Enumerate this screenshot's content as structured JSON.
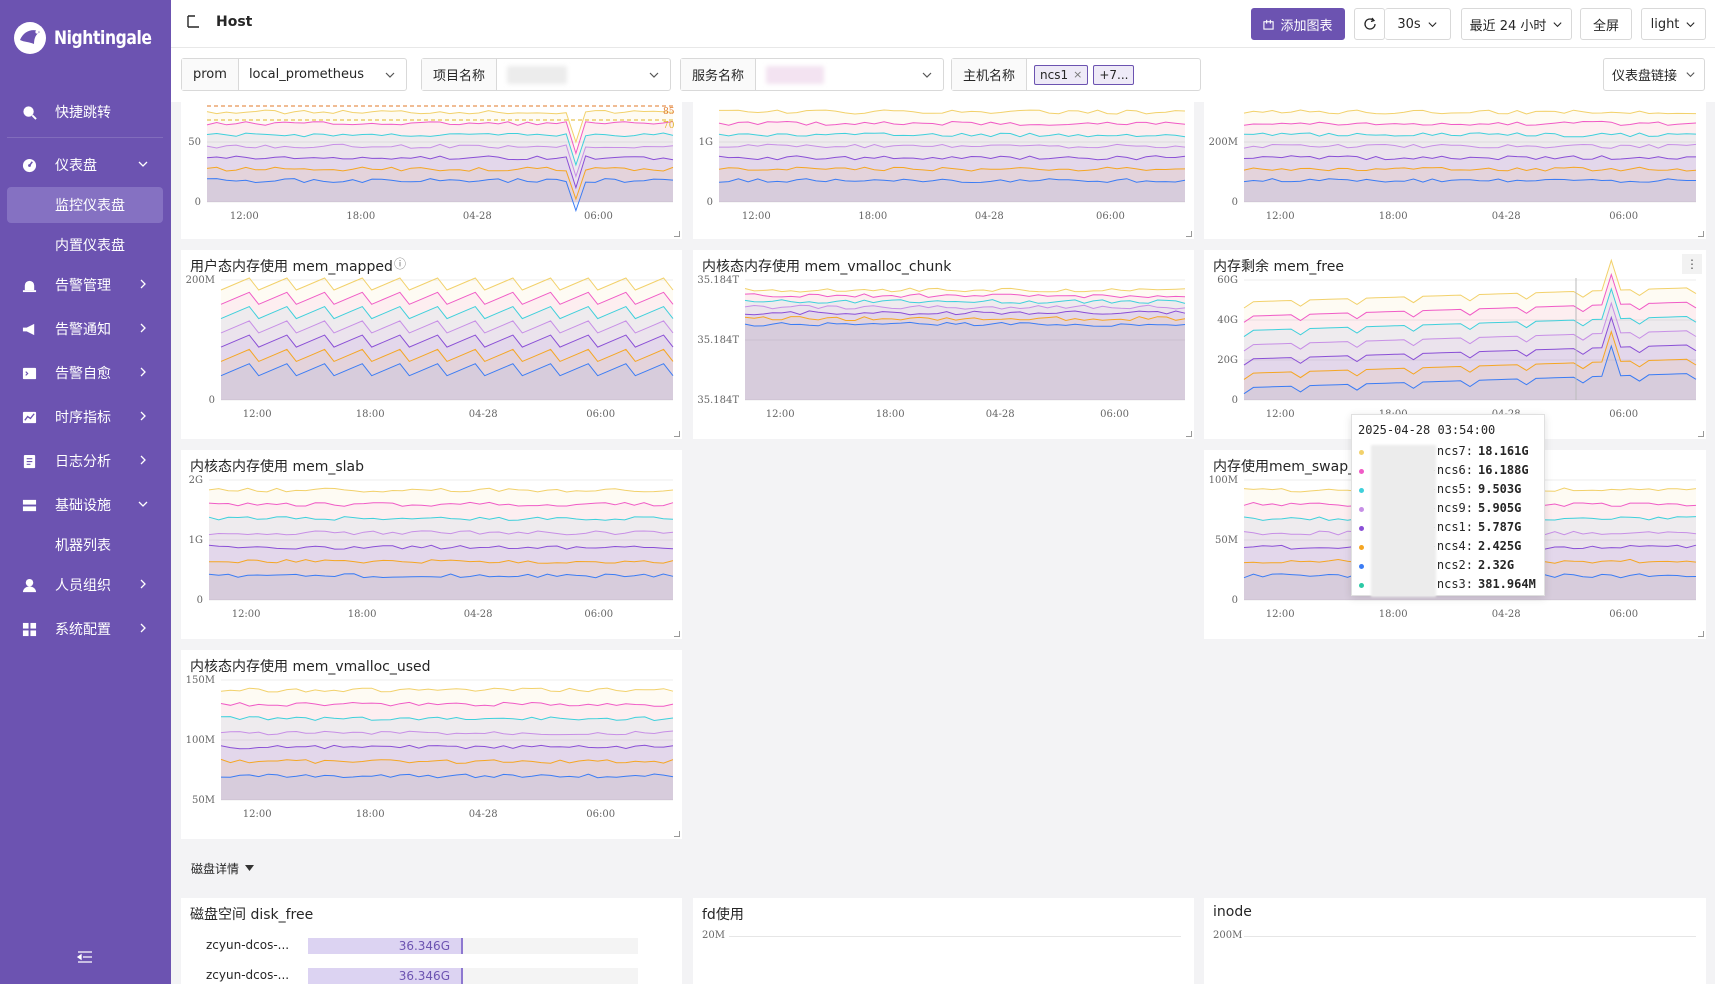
{
  "app": {
    "logo_text": "Nightingale",
    "page_title": "Host"
  },
  "sidebar": {
    "items": [
      {
        "label": "快捷跳转",
        "icon": "search-icon"
      },
      {
        "label": "仪表盘",
        "icon": "dashboard-icon"
      },
      {
        "label": "监控仪表盘",
        "sub": true,
        "active": true
      },
      {
        "label": "内置仪表盘",
        "sub": true
      },
      {
        "label": "告警管理",
        "icon": "alarm-icon"
      },
      {
        "label": "告警通知",
        "icon": "megaphone-icon"
      },
      {
        "label": "告警自愈",
        "icon": "terminal-icon"
      },
      {
        "label": "时序指标",
        "icon": "line-chart-icon"
      },
      {
        "label": "日志分析",
        "icon": "log-icon"
      },
      {
        "label": "基础设施",
        "icon": "server-icon"
      },
      {
        "label": "机器列表",
        "sub": true
      },
      {
        "label": "人员组织",
        "icon": "user-icon"
      },
      {
        "label": "系统配置",
        "icon": "settings-grid-icon"
      }
    ]
  },
  "header": {
    "add_chart": "添加图表",
    "refresh_interval": "30s",
    "time_range": "最近 24 小时",
    "fullscreen": "全屏",
    "theme": "light"
  },
  "filters": {
    "datasource_type": "prom",
    "datasource": "local_prometheus",
    "project_label": "项目名称",
    "service_label": "服务名称",
    "host_label": "主机名称",
    "host_tag": "ncs1",
    "host_more": "+7...",
    "dashboard_link": "仪表盘链接"
  },
  "panels": {
    "p_top1": {
      "yticks": [
        "50",
        "0"
      ],
      "thresholds": [
        "85",
        "70"
      ]
    },
    "p_top2": {
      "yticks": [
        "1G",
        "0"
      ]
    },
    "p_top3": {
      "yticks": [
        "200M",
        "0"
      ]
    },
    "p_mapped": {
      "title": "用户态内存使用 mem_mapped",
      "yticks": [
        "200M",
        "0"
      ]
    },
    "p_vchunk": {
      "title": "内核态内存使用 mem_vmalloc_chunk",
      "yticks": [
        "35.184T",
        "35.184T",
        "35.184T"
      ]
    },
    "p_free": {
      "title": "内存剩余 mem_free",
      "yticks": [
        "60G",
        "40G",
        "20G",
        "0"
      ]
    },
    "p_slab": {
      "title": "内核态内存使用 mem_slab",
      "yticks": [
        "2G",
        "1G",
        "0"
      ]
    },
    "p_swap": {
      "title": "内存使用mem_swap_t",
      "yticks": [
        "100M",
        "50M",
        "0"
      ]
    },
    "p_vused": {
      "title": "内核态内存使用 mem_vmalloc_used",
      "yticks": [
        "150M",
        "100M",
        "50M"
      ]
    },
    "xticks": [
      "12:00",
      "18:00",
      "04-28",
      "06:00"
    ]
  },
  "section": {
    "disk": "磁盘详情"
  },
  "disk_panels": {
    "disk_free": {
      "title": "磁盘空间 disk_free",
      "rows": [
        {
          "label": "zcyun-dcos-...",
          "value": "36.346G"
        },
        {
          "label": "zcyun-dcos-...",
          "value": "36.346G"
        }
      ]
    },
    "fd": {
      "title": "fd使用",
      "ytick": "20M"
    },
    "inode": {
      "title": "inode",
      "ytick": "200M"
    }
  },
  "tooltip": {
    "time": "2025-04-28 03:54:00",
    "rows": [
      {
        "name": "ncs7:",
        "value": "18.161G",
        "color": "#f2d16b"
      },
      {
        "name": "-ncs6:",
        "value": "16.188G",
        "color": "#f05bc6"
      },
      {
        "name": "-ncs5:",
        "value": "9.503G",
        "color": "#3fd0db"
      },
      {
        "name": "-ncs9:",
        "value": "5.905G",
        "color": "#c78fe6"
      },
      {
        "name": "-ncs1:",
        "value": "5.787G",
        "color": "#8a4fd6"
      },
      {
        "name": "-ncs4:",
        "value": "2.425G",
        "color": "#f5a623"
      },
      {
        "name": "ncs2:",
        "value": "2.32G",
        "color": "#3b7cf4"
      },
      {
        "name": "ncs3:",
        "value": "381.964M",
        "color": "#2cc9a5"
      }
    ]
  },
  "colors": {
    "brand": "#6c53b1",
    "sidebar_active": "#8571c2"
  }
}
